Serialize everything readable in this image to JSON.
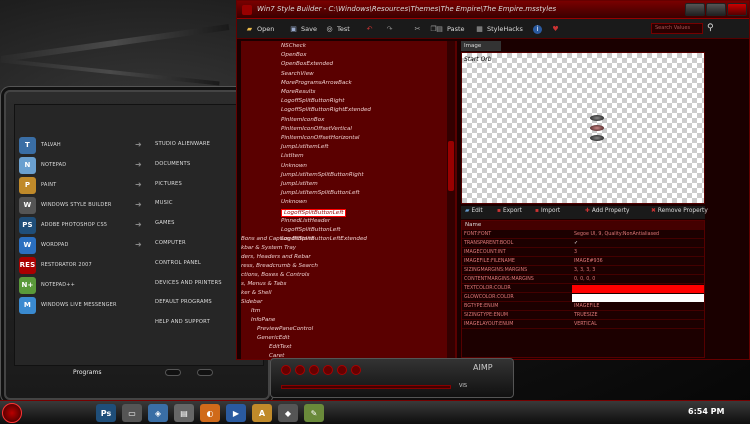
{
  "window": {
    "title": "Win7 Style Builder - C:\\Windows\\Resources\\Themes\\The Empire\\The Empire.msstyles"
  },
  "toolbar": {
    "open": "Open",
    "save": "Save",
    "test": "Test",
    "paste": "Paste",
    "stylehacks": "StyleHacks",
    "search_placeholder": "Search Values"
  },
  "tree": {
    "items": [
      "NSCheck",
      "OpenBox",
      "OpenBoxExtended",
      "SearchView",
      "MoreProgramsArrowBack",
      "MoreResults",
      "LogoffSplitButtonRight",
      "LogoffSplitButtonRightExtended",
      "PinItemIconBox",
      "PinItemIconOffsetVertical",
      "PinItemIconOffsetHorizontal",
      "JumpListItemLeft",
      "ListItem",
      "Unknown",
      "JumpListItemSplitButtonRight",
      "JumpListItem",
      "JumpListItemSplitButtonLeft",
      "Unknown",
      "LogoffSplitButtonLeft",
      "PinnedListHeader",
      "LogoffSplitButtonLeft",
      "LogoffSplitButtonLeftExtended"
    ],
    "sections": [
      "Bons and Caption Buttons",
      "kbar & System Tray",
      "ders, Headers and Rebar",
      "ress, Breadcrumb & Search",
      "ctions, Boxes & Controls",
      "s, Menus & Tabs",
      "ker & Shell",
      "Sidebar",
      "Itm",
      "InfoPane",
      "PreviewPaneControl",
      "GenericEdit",
      "EditText",
      "Caret"
    ]
  },
  "image_pane": {
    "tab": "Image",
    "caption": "Start Orb"
  },
  "prop_tools": {
    "edit": "Edit",
    "export": "Export",
    "import": "Import",
    "add_property": "Add Property",
    "remove_property": "Remove Property"
  },
  "grid": {
    "header_name": "Name",
    "rows": [
      {
        "name": "FONT:FONT",
        "value": "Segoe UI, 9, Quality:NonAntialiased"
      },
      {
        "name": "TRANSPARENT:BOOL",
        "value": "✓"
      },
      {
        "name": "IMAGECOUNT:INT",
        "value": "3"
      },
      {
        "name": "IMAGEFILE:FILENAME",
        "value": "IMAGE#936"
      },
      {
        "name": "SIZINGMARGINS:MARGINS",
        "value": "3, 3, 3, 3"
      },
      {
        "name": "CONTENTMARGINS:MARGINS",
        "value": "0, 0, 0, 0"
      },
      {
        "name": "TEXTCOLOR:COLOR",
        "value": ""
      },
      {
        "name": "GLOWCOLOR:COLOR",
        "value": ""
      },
      {
        "name": "BGTYPE:ENUM",
        "value": "IMAGEFILE"
      },
      {
        "name": "SIZINGTYPE:ENUM",
        "value": "TRUESIZE"
      },
      {
        "name": "IMAGELAYOUT:ENUM",
        "value": "VERTICAL"
      }
    ]
  },
  "start_menu": {
    "left_items": [
      {
        "label": "Talvah",
        "icon": "talvah-icon",
        "color": "#3a6ea5",
        "glyph": "T"
      },
      {
        "label": "Notepad",
        "icon": "notepad-icon",
        "color": "#6aa0d0",
        "glyph": "N"
      },
      {
        "label": "Paint",
        "icon": "paint-icon",
        "color": "#c08a2a",
        "glyph": "P"
      },
      {
        "label": "Windows Style Builder",
        "icon": "style-builder-icon",
        "color": "#555",
        "glyph": "W"
      },
      {
        "label": "Adobe Photoshop CS5",
        "icon": "photoshop-icon",
        "color": "#1f4e79",
        "glyph": "Ps"
      },
      {
        "label": "WordPad",
        "icon": "wordpad-icon",
        "color": "#2a6fc0",
        "glyph": "W"
      },
      {
        "label": "Restorator 2007",
        "icon": "restorator-icon",
        "color": "#a00",
        "glyph": "Res"
      },
      {
        "label": "Notepad++",
        "icon": "notepadpp-icon",
        "color": "#5a9a3a",
        "glyph": "N+"
      },
      {
        "label": "Windows Live Messenger",
        "icon": "messenger-icon",
        "color": "#3a8ad0",
        "glyph": "M"
      }
    ],
    "right_items": [
      "Studio Alienware",
      "Documents",
      "Pictures",
      "Music",
      "Games",
      "Computer",
      "Control Panel",
      "Devices and Printers",
      "Default Programs",
      "Help and Support"
    ],
    "programs_label": "Programs"
  },
  "player": {
    "brand": "AIMP",
    "vis": "VIS"
  },
  "taskbar": {
    "clock": "6:54 PM",
    "apps": [
      {
        "icon": "photoshop-task-icon",
        "glyph": "Ps",
        "color": "#1f4e79"
      },
      {
        "icon": "folder-task-icon",
        "glyph": "▭",
        "color": "#555"
      },
      {
        "icon": "explorer-task-icon",
        "glyph": "◈",
        "color": "#3a6ea5"
      },
      {
        "icon": "document-task-icon",
        "glyph": "▤",
        "color": "#666"
      },
      {
        "icon": "firefox-task-icon",
        "glyph": "◐",
        "color": "#d06a1a"
      },
      {
        "icon": "mediaplayer-task-icon",
        "glyph": "▶",
        "color": "#2a5aa0"
      },
      {
        "icon": "aimp-task-icon",
        "glyph": "A",
        "color": "#c08a2a"
      },
      {
        "icon": "style-task-icon",
        "glyph": "◆",
        "color": "#555"
      },
      {
        "icon": "paint-task-icon",
        "glyph": "✎",
        "color": "#6a8a3a"
      }
    ]
  }
}
